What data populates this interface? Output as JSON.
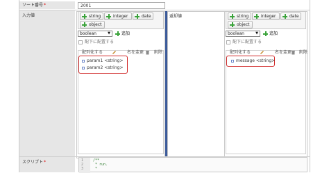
{
  "sort_number": {
    "label": "ソート番号",
    "required_mark": "*",
    "value": "2001"
  },
  "input_values": {
    "label": "入力値",
    "type_buttons": [
      "string",
      "integer",
      "date",
      "object"
    ],
    "select_value": "boolean",
    "add_label": "追加",
    "checkbox_label": "配下に配置する",
    "tree_tools": {
      "array": "配列化する",
      "rename": "名を変更",
      "delete": "削除"
    },
    "params": [
      "param1 <string>",
      "param2 <string>"
    ]
  },
  "return_values": {
    "label": "返却値",
    "type_buttons": [
      "string",
      "integer",
      "date",
      "object"
    ],
    "select_value": "boolean",
    "add_label": "追加",
    "checkbox_label": "配下に配置する",
    "tree_tools": {
      "array": "配列化する",
      "rename": "名を変更",
      "delete": "削除"
    },
    "params": [
      "message <string>"
    ]
  },
  "script": {
    "label": "スクリプト",
    "required_mark": "*",
    "line_numbers": [
      "1",
      "2",
      "3"
    ],
    "lines": [
      "/**",
      " * run.",
      " *"
    ]
  },
  "colors": {
    "highlight": "#d12a2a",
    "plus": "#3aa33a",
    "divider": "#3b5a9a"
  }
}
